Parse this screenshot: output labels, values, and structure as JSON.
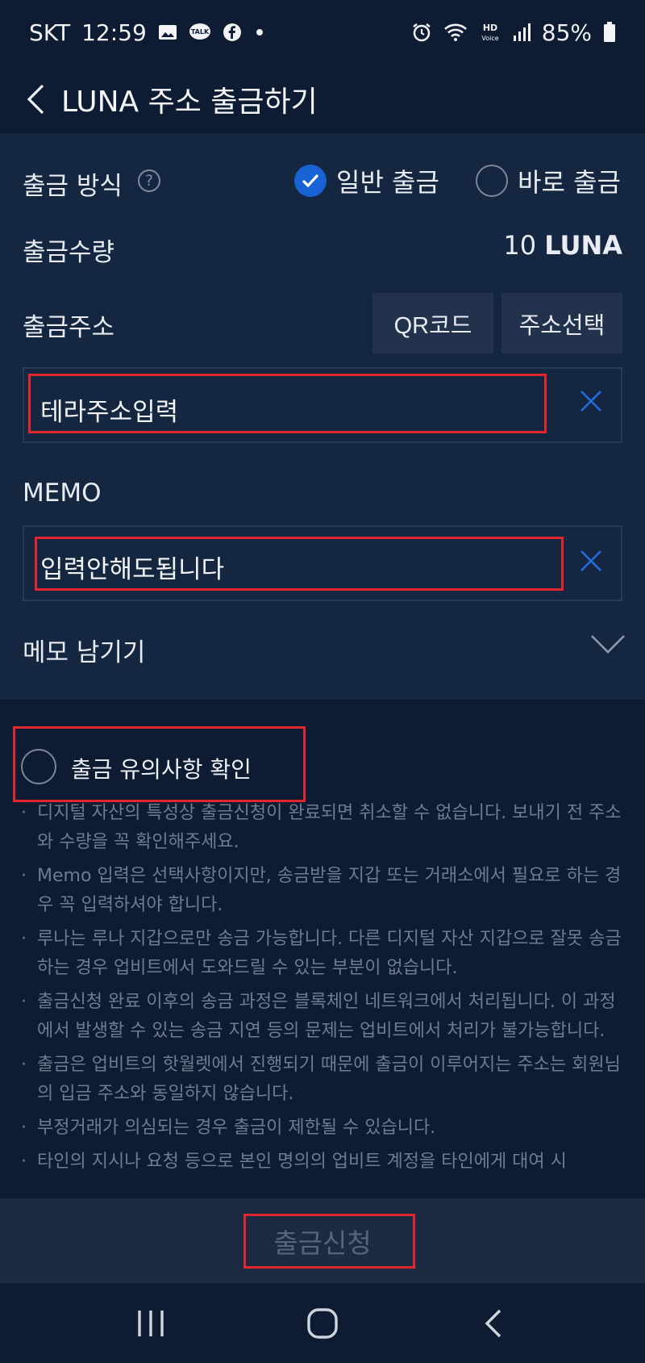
{
  "status_bar": {
    "carrier": "SKT",
    "time": "12:59",
    "battery": "85%",
    "left_icons": [
      "gallery-icon",
      "kakaotalk-icon",
      "facebook-icon",
      "dot-icon"
    ],
    "right_icons": [
      "alarm-icon",
      "wifi-icon",
      "hd-voice-icon",
      "signal-icon",
      "battery-icon"
    ]
  },
  "header": {
    "title": "LUNA 주소 출금하기"
  },
  "form": {
    "method_label": "출금 방식",
    "method_options": [
      {
        "label": "일반 출금",
        "selected": true
      },
      {
        "label": "바로 출금",
        "selected": false
      }
    ],
    "amount_label": "출금수량",
    "amount_value": "10",
    "amount_unit": "LUNA",
    "address_label": "출금주소",
    "qr_button": "QR코드",
    "select_address_button": "주소선택",
    "address_value": "테라주소입력",
    "memo_label": "MEMO",
    "memo_value": "입력안해도됩니다",
    "leave_memo_label": "메모 남기기"
  },
  "notice": {
    "confirm_label": "출금 유의사항 확인",
    "items": [
      "디지털 자산의 특성상 출금신청이 완료되면 취소할 수 없습니다. 보내기 전 주소와 수량을 꼭 확인해주세요.",
      "Memo 입력은 선택사항이지만, 송금받을 지갑 또는 거래소에서 필요로 하는 경우 꼭 입력하셔야 합니다.",
      "루나는 루나 지갑으로만 송금 가능합니다. 다른 디지털 자산 지갑으로 잘못 송금하는 경우 업비트에서 도와드릴 수 있는 부분이 없습니다.",
      "출금신청 완료 이후의 송금 과정은 블록체인 네트워크에서 처리됩니다. 이 과정에서 발생할 수 있는 송금 지연 등의 문제는 업비트에서 처리가 불가능합니다.",
      "출금은 업비트의 핫월렛에서 진행되기 때문에 출금이 이루어지는 주소는 회원님의 입금 주소와 동일하지 않습니다.",
      "부정거래가 의심되는 경우 출금이 제한될 수 있습니다.",
      "타인의 지시나 요청 등으로 본인 명의의 업비트 계정을 타인에게 대여 시"
    ]
  },
  "submit_label": "출금신청",
  "colors": {
    "background": "#0d1b33",
    "card": "#152640",
    "accent": "#1763d6",
    "highlight": "#e2262d"
  }
}
